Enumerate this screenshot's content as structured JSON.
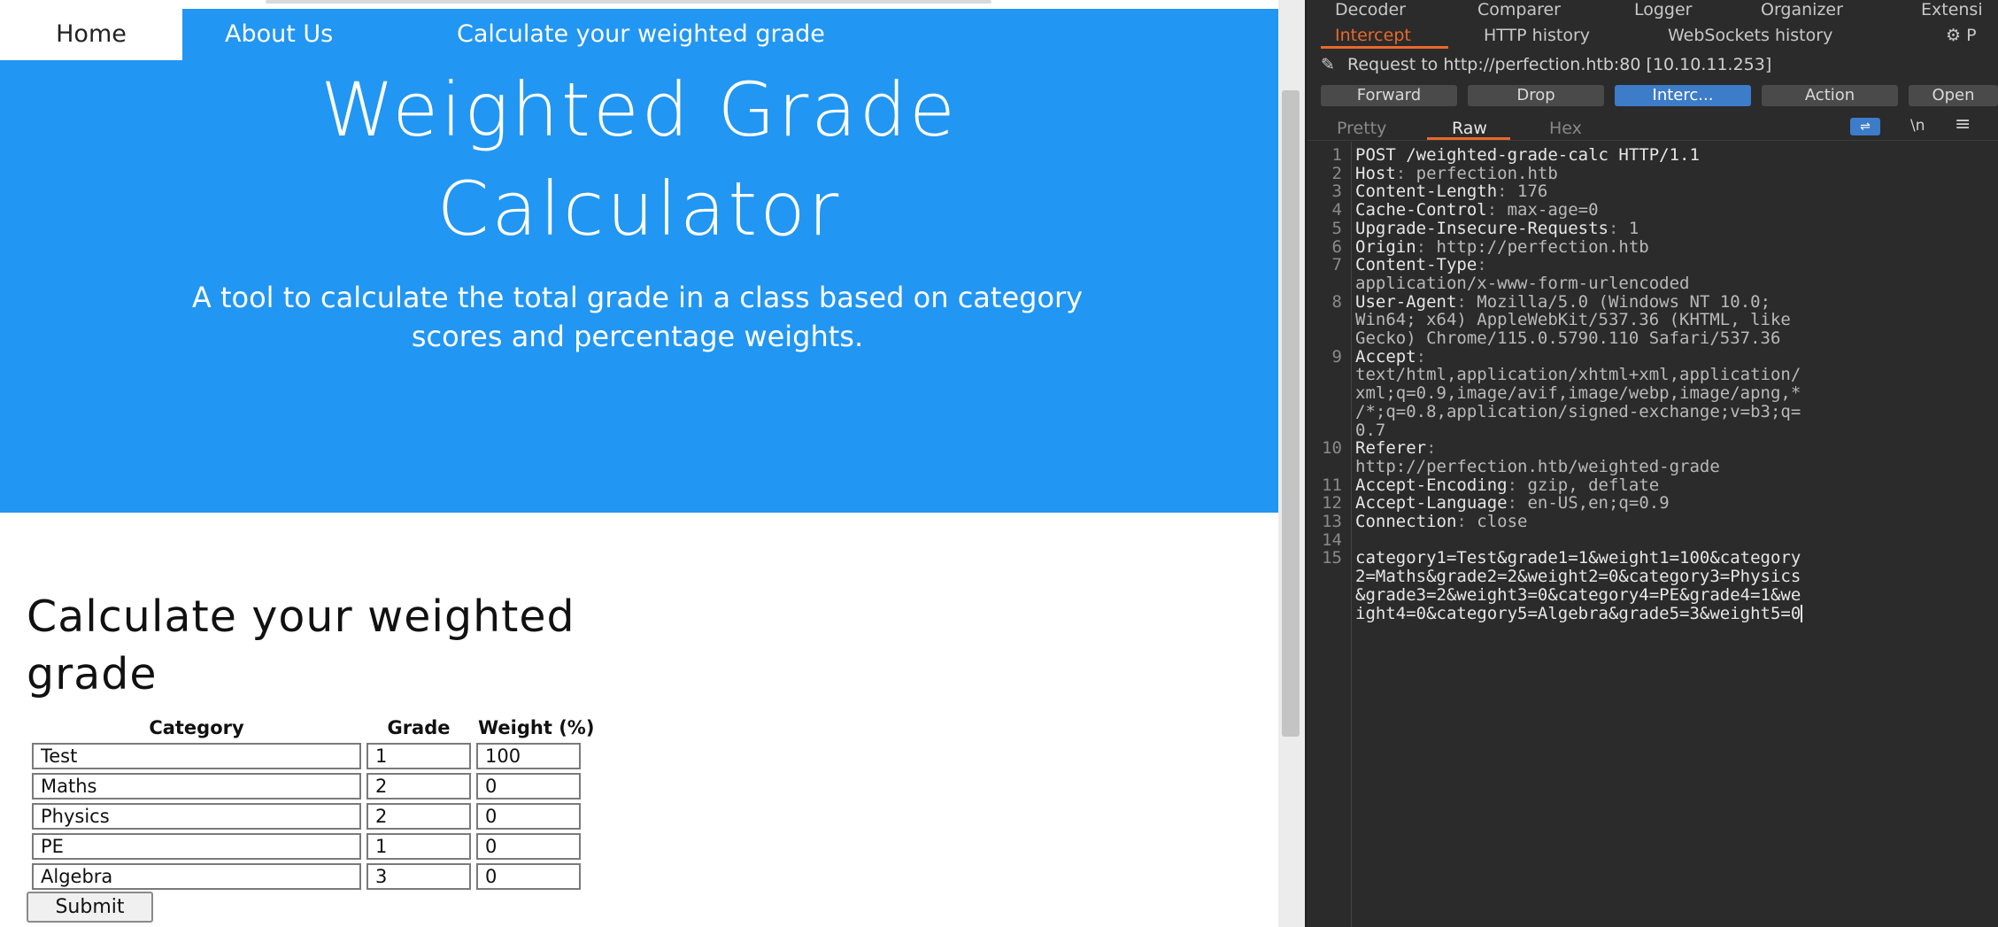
{
  "nav": {
    "home": "Home",
    "about": "About Us",
    "calc": "Calculate your weighted grade"
  },
  "hero": {
    "title_line1": "Weighted Grade",
    "title_line2": "Calculator",
    "subtitle_line1": "A tool to calculate the total grade in a class based on category",
    "subtitle_line2": "scores and percentage weights."
  },
  "form": {
    "title_line1": "Calculate your weighted",
    "title_line2": "grade",
    "headers": [
      "Category",
      "Grade",
      "Weight (%)"
    ],
    "rows": [
      {
        "category": "Test",
        "grade": "1",
        "weight": "100"
      },
      {
        "category": "Maths",
        "grade": "2",
        "weight": "0"
      },
      {
        "category": "Physics",
        "grade": "2",
        "weight": "0"
      },
      {
        "category": "PE",
        "grade": "1",
        "weight": "0"
      },
      {
        "category": "Algebra",
        "grade": "3",
        "weight": "0"
      }
    ],
    "submit_label": "Submit"
  },
  "burp": {
    "top_tabs": [
      "Decoder",
      "Comparer",
      "Logger",
      "Organizer",
      "Extensi"
    ],
    "sub_tabs": [
      "Intercept",
      "HTTP history",
      "WebSockets history",
      "P"
    ],
    "request_to": "Request to http://perfection.htb:80  [10.10.11.253]",
    "buttons": [
      "Forward",
      "Drop",
      "Interc...",
      "Action",
      "Open"
    ],
    "view_tabs": [
      "Pretty",
      "Raw",
      "Hex"
    ],
    "nl_label": "\\n",
    "accent": "#e8692c",
    "button_blue": "#3d7cc8",
    "request": [
      {
        "n": "1",
        "lines": [
          [
            {
              "t": "POST /weighted-grade-calc HTTP/1.1",
              "c": "hk"
            }
          ]
        ]
      },
      {
        "n": "2",
        "lines": [
          [
            {
              "t": "Host",
              "c": "hk"
            },
            {
              "t": ": ",
              "c": "sep"
            },
            {
              "t": "perfection.htb",
              "c": "hv"
            }
          ]
        ]
      },
      {
        "n": "3",
        "lines": [
          [
            {
              "t": "Content-Length",
              "c": "hk"
            },
            {
              "t": ": ",
              "c": "sep"
            },
            {
              "t": "176",
              "c": "hv"
            }
          ]
        ]
      },
      {
        "n": "4",
        "lines": [
          [
            {
              "t": "Cache-Control",
              "c": "hk"
            },
            {
              "t": ": ",
              "c": "sep"
            },
            {
              "t": "max-age=0",
              "c": "hv"
            }
          ]
        ]
      },
      {
        "n": "5",
        "lines": [
          [
            {
              "t": "Upgrade-Insecure-Requests",
              "c": "hk"
            },
            {
              "t": ": ",
              "c": "sep"
            },
            {
              "t": "1",
              "c": "hv"
            }
          ]
        ]
      },
      {
        "n": "6",
        "lines": [
          [
            {
              "t": "Origin",
              "c": "hk"
            },
            {
              "t": ": ",
              "c": "sep"
            },
            {
              "t": "http://perfection.htb",
              "c": "hv"
            }
          ]
        ]
      },
      {
        "n": "7",
        "lines": [
          [
            {
              "t": "Content-Type",
              "c": "hk"
            },
            {
              "t": ":",
              "c": "sep"
            }
          ],
          [
            {
              "t": "application/x-www-form-urlencoded",
              "c": "hv"
            }
          ]
        ]
      },
      {
        "n": "8",
        "lines": [
          [
            {
              "t": "User-Agent",
              "c": "hk"
            },
            {
              "t": ": ",
              "c": "sep"
            },
            {
              "t": "Mozilla/5.0 (Windows NT 10.0;",
              "c": "hv"
            }
          ],
          [
            {
              "t": "Win64; x64) AppleWebKit/537.36 (KHTML, like",
              "c": "hv"
            }
          ],
          [
            {
              "t": "Gecko) Chrome/115.0.5790.110 Safari/537.36",
              "c": "hv"
            }
          ]
        ]
      },
      {
        "n": "9",
        "lines": [
          [
            {
              "t": "Accept",
              "c": "hk"
            },
            {
              "t": ":",
              "c": "sep"
            }
          ],
          [
            {
              "t": "text/html,application/xhtml+xml,application/",
              "c": "hv"
            }
          ],
          [
            {
              "t": "xml;q=0.9,image/avif,image/webp,image/apng,*",
              "c": "hv"
            }
          ],
          [
            {
              "t": "/*;q=0.8,application/signed-exchange;v=b3;q=",
              "c": "hv"
            }
          ],
          [
            {
              "t": "0.7",
              "c": "hv"
            }
          ]
        ]
      },
      {
        "n": "10",
        "lines": [
          [
            {
              "t": "Referer",
              "c": "hk"
            },
            {
              "t": ":",
              "c": "sep"
            }
          ],
          [
            {
              "t": "http://perfection.htb/weighted-grade",
              "c": "hv"
            }
          ]
        ]
      },
      {
        "n": "11",
        "lines": [
          [
            {
              "t": "Accept-Encoding",
              "c": "hk"
            },
            {
              "t": ": ",
              "c": "sep"
            },
            {
              "t": "gzip, deflate",
              "c": "hv"
            }
          ]
        ]
      },
      {
        "n": "12",
        "lines": [
          [
            {
              "t": "Accept-Language",
              "c": "hk"
            },
            {
              "t": ": ",
              "c": "sep"
            },
            {
              "t": "en-US,en;q=0.9",
              "c": "hv"
            }
          ]
        ]
      },
      {
        "n": "13",
        "lines": [
          [
            {
              "t": "Connection",
              "c": "hk"
            },
            {
              "t": ": ",
              "c": "sep"
            },
            {
              "t": "close",
              "c": "hv"
            }
          ]
        ]
      },
      {
        "n": "14",
        "lines": [
          [
            {
              "t": "",
              "c": "hv"
            }
          ]
        ]
      },
      {
        "n": "15",
        "lines": [
          [
            {
              "t": "category1=Test&grade1=1&weight1=100&category",
              "c": "hk"
            }
          ],
          [
            {
              "t": "2=Maths&grade2=2&weight2=0&category3=Physics",
              "c": "hk"
            }
          ],
          [
            {
              "t": "&grade3=2&weight3=0&category4=PE&grade4=1&we",
              "c": "hk"
            }
          ],
          [
            {
              "t": "ight4=0&category5=Algebra&grade5=3&weight5=0",
              "c": "hk"
            }
          ]
        ]
      }
    ]
  }
}
